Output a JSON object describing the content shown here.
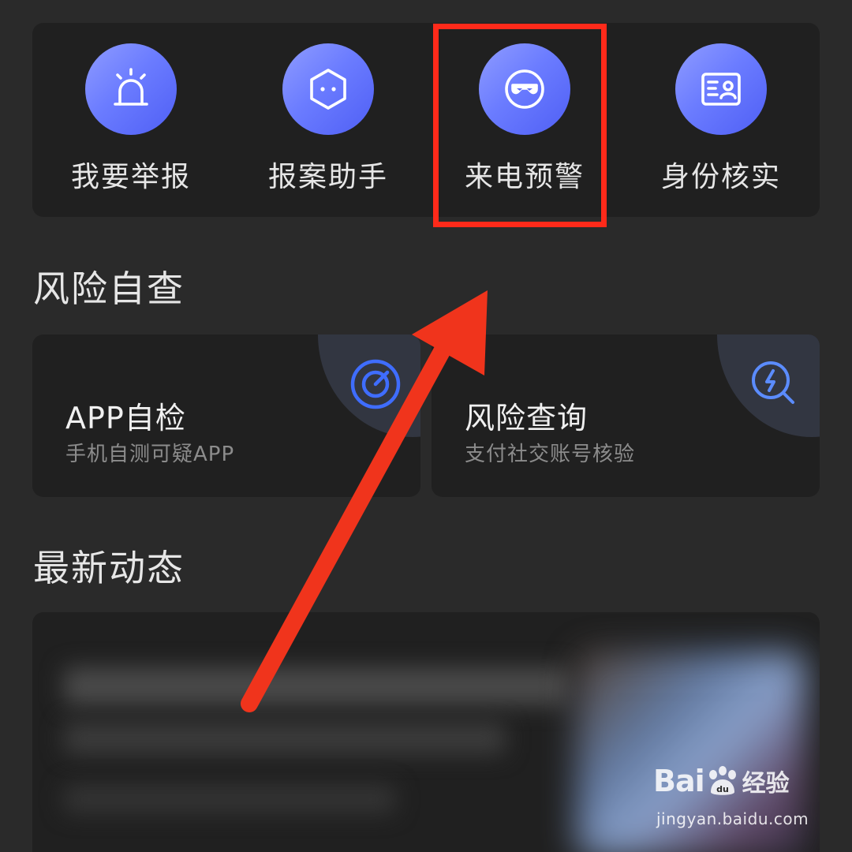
{
  "quick_actions": {
    "items": [
      {
        "label": "我要举报",
        "icon": "siren-icon"
      },
      {
        "label": "报案助手",
        "icon": "cube-face-icon"
      },
      {
        "label": "来电预警",
        "icon": "masked-face-icon"
      },
      {
        "label": "身份核实",
        "icon": "id-card-icon"
      }
    ]
  },
  "risk_check": {
    "title": "风险自查",
    "cards": [
      {
        "title": "APP自检",
        "subtitle": "手机自测可疑APP",
        "icon": "radar-target-icon"
      },
      {
        "title": "风险查询",
        "subtitle": "支付社交账号核验",
        "icon": "search-lightning-icon"
      }
    ]
  },
  "news": {
    "title": "最新动态"
  },
  "watermark": {
    "brand_latin": "Bai",
    "brand_du": "du",
    "brand_cn": "经验",
    "url": "jingyan.baidu.com"
  },
  "colors": {
    "background": "#2a2a2a",
    "card": "#202020",
    "accent_gradient_start": "#8f9cff",
    "accent_gradient_end": "#4f5ff5",
    "annotation_red": "#ff2a1a",
    "text_primary": "#e6e6e6",
    "text_secondary": "#8c8c8c"
  }
}
